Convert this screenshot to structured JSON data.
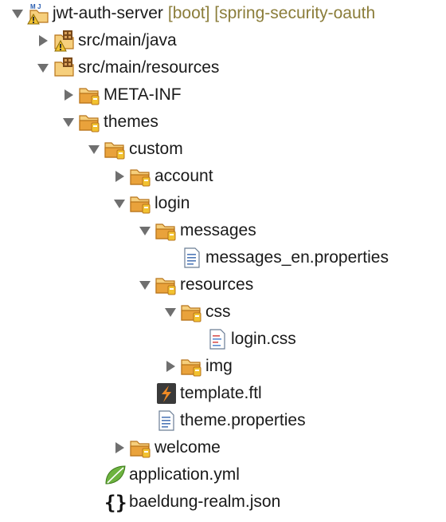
{
  "tree": {
    "nodes": [
      {
        "depth": 0,
        "label": "jwt-auth-server",
        "annotation": "[boot] [spring-security-oauth",
        "state": "expanded",
        "icon": "maven-project-warning-icon"
      },
      {
        "depth": 1,
        "label": "src/main/java",
        "state": "collapsed",
        "icon": "source-folder-warning-icon"
      },
      {
        "depth": 1,
        "label": "src/main/resources",
        "state": "expanded",
        "icon": "source-folder-icon"
      },
      {
        "depth": 2,
        "label": "META-INF",
        "state": "collapsed",
        "icon": "folder-icon"
      },
      {
        "depth": 2,
        "label": "themes",
        "state": "expanded",
        "icon": "folder-icon"
      },
      {
        "depth": 3,
        "label": "custom",
        "state": "expanded",
        "icon": "folder-icon"
      },
      {
        "depth": 4,
        "label": "account",
        "state": "collapsed",
        "icon": "folder-icon"
      },
      {
        "depth": 4,
        "label": "login",
        "state": "expanded",
        "icon": "folder-icon"
      },
      {
        "depth": 5,
        "label": "messages",
        "state": "expanded",
        "icon": "folder-icon"
      },
      {
        "depth": 6,
        "label": "messages_en.properties",
        "state": "leaf",
        "icon": "properties-file-icon"
      },
      {
        "depth": 5,
        "label": "resources",
        "state": "expanded",
        "icon": "folder-icon"
      },
      {
        "depth": 6,
        "label": "css",
        "state": "expanded",
        "icon": "folder-icon"
      },
      {
        "depth": 7,
        "label": "login.css",
        "state": "leaf",
        "icon": "css-file-icon"
      },
      {
        "depth": 6,
        "label": "img",
        "state": "collapsed",
        "icon": "folder-icon"
      },
      {
        "depth": 5,
        "label": "template.ftl",
        "state": "leaf",
        "icon": "freemarker-file-icon"
      },
      {
        "depth": 5,
        "label": "theme.properties",
        "state": "leaf",
        "icon": "properties-file-icon"
      },
      {
        "depth": 4,
        "label": "welcome",
        "state": "collapsed",
        "icon": "folder-icon"
      },
      {
        "depth": 3,
        "label": "application.yml",
        "state": "leaf",
        "icon": "spring-yml-file-icon"
      },
      {
        "depth": 3,
        "label": "baeldung-realm.json",
        "state": "leaf",
        "icon": "json-file-icon"
      }
    ]
  },
  "colors": {
    "text": "#1a1a1a",
    "annotation": "#8b7d3a",
    "arrow": "#6f6f6f",
    "folder": "#e9a23b",
    "folder_dark": "#b8741a",
    "package_badge": "#f2c230"
  }
}
